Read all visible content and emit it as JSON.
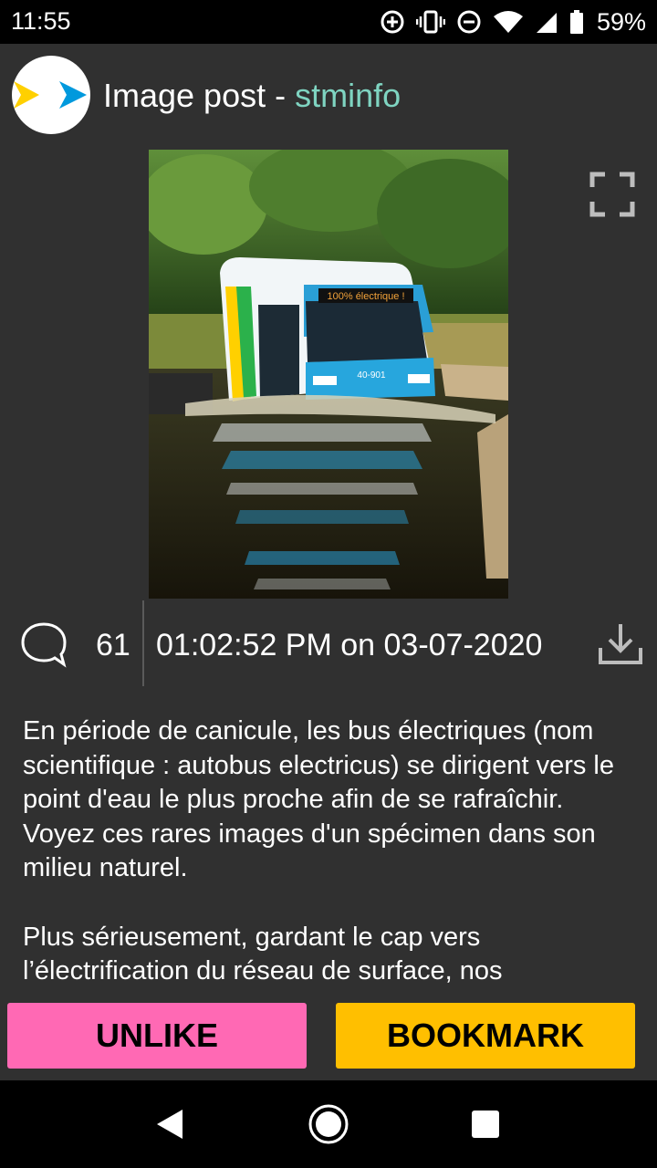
{
  "status_bar": {
    "time": "11:55",
    "battery": "59%",
    "icons": [
      "data-saver-icon",
      "vibrate-icon",
      "do-not-disturb-icon",
      "wifi-icon",
      "signal-icon",
      "battery-icon"
    ]
  },
  "header": {
    "title_prefix": "Image post - ",
    "username": "stminfo",
    "avatar_icon": "arrows-logo-icon"
  },
  "post": {
    "image_alt": "Electric bus driving through water",
    "bus_sign": "100% électrique !",
    "bus_number": "40-901",
    "comment_count": "61",
    "timestamp": "01:02:52 PM on 03-07-2020",
    "description": [
      "En période de canicule, les bus électriques (nom scientifique : autobus electricus) se dirigent vers le point d'eau le plus proche afin de se rafraîchir. Voyez ces rares images d'un spécimen dans son milieu naturel.",
      "Plus sérieusement, gardant le cap vers l’électrification du réseau de surface, nos"
    ]
  },
  "actions": {
    "unlike_label": "UNLIKE",
    "bookmark_label": "BOOKMARK"
  },
  "colors": {
    "background": "#303030",
    "accent_username": "#7fd4c1",
    "unlike": "#ff69b4",
    "bookmark": "#ffbf00"
  },
  "nav": {
    "icons": [
      "back-icon",
      "home-icon",
      "recent-apps-icon"
    ]
  }
}
